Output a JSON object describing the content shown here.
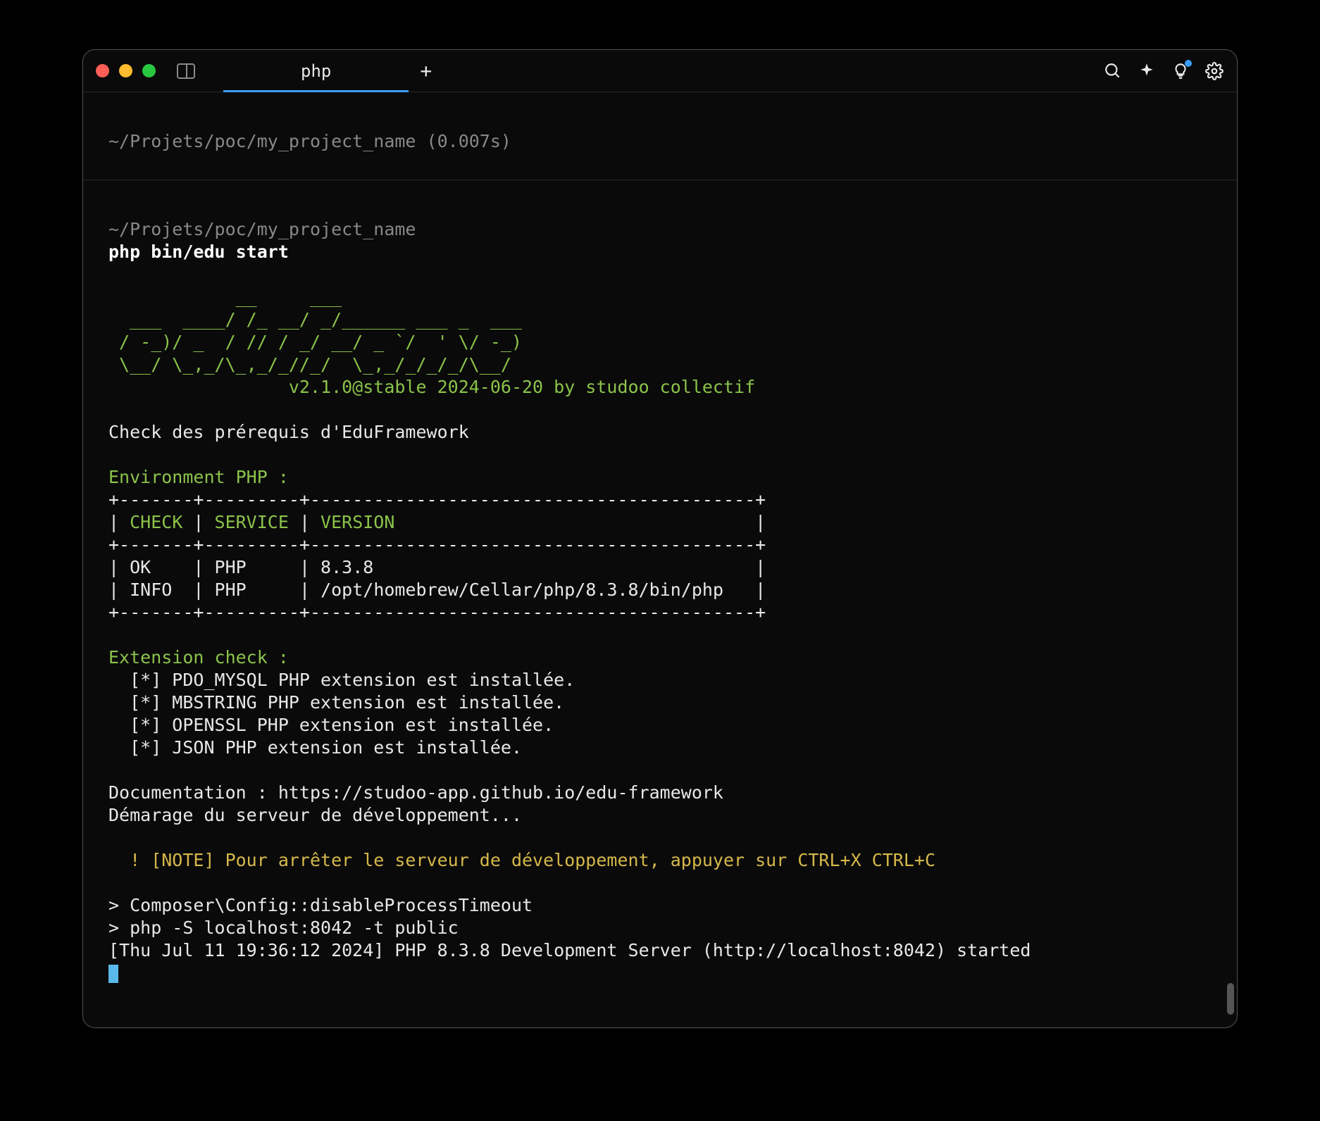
{
  "window": {
    "tab_title": "php",
    "new_tab": "+"
  },
  "prompt1": {
    "path": "~/Projets/poc/my_project_name (0.007s)"
  },
  "prompt2": {
    "path": "~/Projets/poc/my_project_name",
    "command": "php bin/edu start"
  },
  "ascii_logo": "            __     ___\n  ___  ____/ /_ __/ _/______ ___ _  ___\n / -_)/ _  / // / _/ __/ _ `/  ' \\/ -_)\n \\__/ \\_,_/\\_,_/_//_/  \\_,_/_/_/_/\\__/",
  "version_line": "                 v2.1.0@stable 2024-06-20 by studoo collectif",
  "check_heading": "Check des prérequis d'EduFramework",
  "env_heading": "Environment PHP :",
  "table": {
    "border_top": "+-------+---------+------------------------------------------+",
    "header_check": "CHECK",
    "header_service": "SERVICE",
    "header_version": "VERSION",
    "border_mid": "+-------+---------+------------------------------------------+",
    "row1_check": "OK",
    "row1_service": "PHP",
    "row1_version": "8.3.8",
    "row2_check": "INFO",
    "row2_service": "PHP",
    "row2_version": "/opt/homebrew/Cellar/php/8.3.8/bin/php",
    "border_bottom": "+-------+---------+------------------------------------------+"
  },
  "ext_heading": "Extension check :",
  "extensions": {
    "pdo": "  [*] PDO_MYSQL PHP extension est installée.",
    "mbstring": "  [*] MBSTRING PHP extension est installée.",
    "openssl": "  [*] OPENSSL PHP extension est installée.",
    "json": "  [*] JSON PHP extension est installée."
  },
  "doc_line": "Documentation : https://studoo-app.github.io/edu-framework",
  "start_line": "Démarage du serveur de développement...",
  "note_line": "  ! [NOTE] Pour arrêter le serveur de développement, appuyer sur CTRL+X CTRL+C",
  "composer_line": "> Composer\\Config::disableProcessTimeout",
  "serve_line": "> php -S localhost:8042 -t public",
  "server_started": "[Thu Jul 11 19:36:12 2024] PHP 8.3.8 Development Server (http://localhost:8042) started"
}
